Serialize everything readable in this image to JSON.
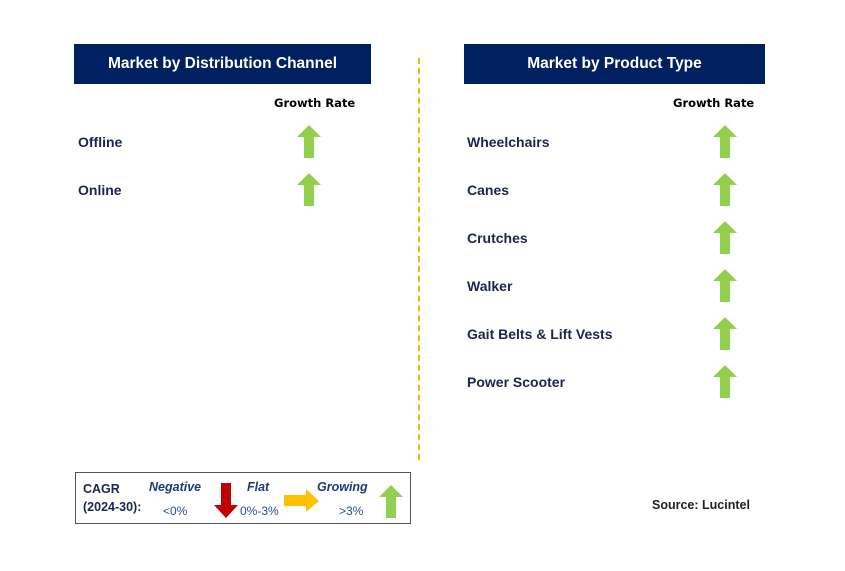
{
  "left": {
    "title": "Market by Distribution Channel",
    "growth_header": "Growth Rate",
    "items": [
      {
        "label": "Offline",
        "trend": "growing"
      },
      {
        "label": "Online",
        "trend": "growing"
      }
    ]
  },
  "right": {
    "title": "Market by Product Type",
    "growth_header": "Growth Rate",
    "items": [
      {
        "label": "Wheelchairs",
        "trend": "growing"
      },
      {
        "label": "Canes",
        "trend": "growing"
      },
      {
        "label": "Crutches",
        "trend": "growing"
      },
      {
        "label": "Walker",
        "trend": "growing"
      },
      {
        "label": "Gait Belts & Lift Vests",
        "trend": "growing"
      },
      {
        "label": "Power Scooter",
        "trend": "growing"
      }
    ]
  },
  "legend": {
    "cagr": "CAGR",
    "period": "(2024-30):",
    "negative": "Negative",
    "negative_range": "<0%",
    "flat": "Flat",
    "flat_range": "0%-3%",
    "growing": "Growing",
    "growing_range": ">3%"
  },
  "source": "Source: Lucintel",
  "colors": {
    "header": "#002060",
    "growing": "#92d050",
    "negative": "#c00000",
    "flat": "#ffc000",
    "divider": "#f5b800"
  }
}
